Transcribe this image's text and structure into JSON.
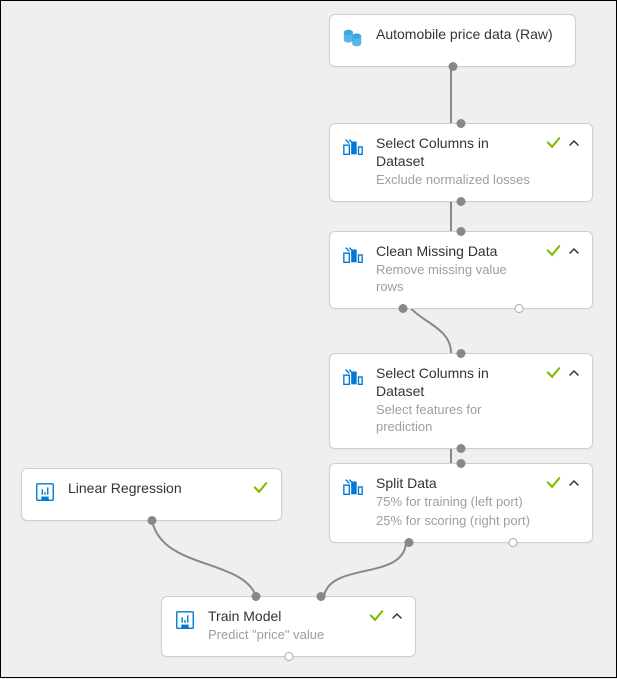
{
  "nodes": {
    "data_source": {
      "title": "Automobile price data (Raw)"
    },
    "select_cols_1": {
      "title": "Select Columns in Dataset",
      "subtitle": "Exclude normalized losses"
    },
    "clean_missing": {
      "title": "Clean Missing Data",
      "subtitle": "Remove missing value rows"
    },
    "select_cols_2": {
      "title": "Select Columns in Dataset",
      "subtitle": "Select features for prediction"
    },
    "linear_regression": {
      "title": "Linear Regression"
    },
    "split_data": {
      "title": "Split Data",
      "subtitle_1": "75% for training (left port)",
      "subtitle_2": "25% for scoring (right port)"
    },
    "train_model": {
      "title": "Train Model",
      "subtitle": "Predict \"price\" value"
    }
  }
}
